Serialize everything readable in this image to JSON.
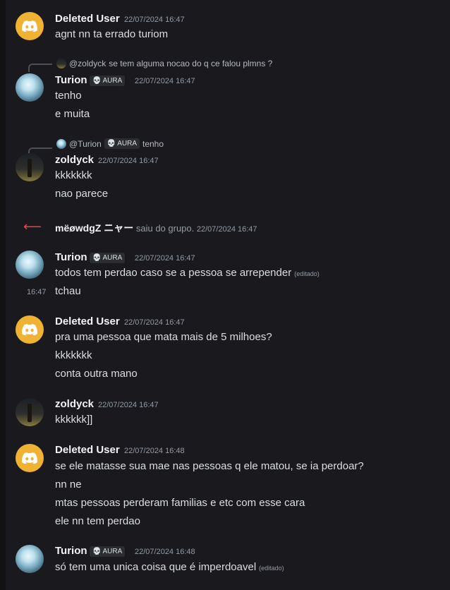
{
  "messages": [
    {
      "author": "Deleted User",
      "time": "22/07/2024 16:47",
      "lines": [
        "agnt nn ta errado turiom"
      ]
    },
    {
      "reply": {
        "name": "@zoldyck",
        "text": "se tem alguma nocao do q ce falou plmns ?"
      },
      "author": "Turion",
      "badge": "AURA",
      "time": "22/07/2024 16:47",
      "lines": [
        "tenho",
        "e muita"
      ]
    },
    {
      "reply": {
        "name": "@Turion",
        "badge": "AURA",
        "text": "tenho"
      },
      "author": "zoldyck",
      "time": "22/07/2024 16:47",
      "lines": [
        "kkkkkkk",
        "nao parece"
      ]
    },
    {
      "system": {
        "user": "mëøwdgZ ニャー",
        "action": "saiu do grupo.",
        "time": "22/07/2024 16:47"
      }
    },
    {
      "author": "Turion",
      "badge": "AURA",
      "time": "22/07/2024 16:47",
      "lines": [
        "todos tem perdao caso se a pessoa se arrepender",
        "tchau"
      ],
      "edited": "(editado)",
      "hover_time": "16:47"
    },
    {
      "author": "Deleted User",
      "time": "22/07/2024 16:47",
      "lines": [
        "pra uma pessoa que mata mais de 5 milhoes?",
        "kkkkkkk",
        "conta outra mano"
      ]
    },
    {
      "author": "zoldyck",
      "time": "22/07/2024 16:47",
      "lines": [
        "kkkkkk]]"
      ]
    },
    {
      "author": "Deleted User",
      "time": "22/07/2024 16:48",
      "lines": [
        "se ele matasse sua mae nas pessoas q ele matou, se ia perdoar?",
        "nn ne",
        "mtas pessoas perderam familias e etc com esse cara",
        "ele nn tem perdao"
      ]
    },
    {
      "author": "Turion",
      "badge": "AURA",
      "time": "22/07/2024 16:48",
      "lines": [
        "só tem uma unica coisa que é imperdoavel"
      ],
      "edited": "(editado)"
    }
  ],
  "icons": {
    "discord": "discord-logo-icon",
    "skull": "skull-icon",
    "leave": "arrow-left-icon"
  },
  "colors": {
    "background": "#1a1a1e",
    "discord_avatar": "#f0b232",
    "leave_arrow": "#f23f43"
  }
}
